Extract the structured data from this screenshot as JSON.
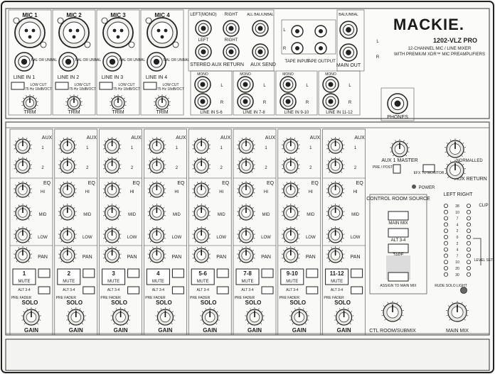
{
  "brand": {
    "logo": "MACKIE.",
    "model": "1202-VLZ PRO",
    "desc1": "12-CHANNEL MIC / LINE MIXER",
    "desc2": "WITH PREMIUM XDR™ MIC PREAMPLIFIERS"
  },
  "mic_inputs": [
    {
      "mic": "MIC 1",
      "line": "LINE IN 1"
    },
    {
      "mic": "MIC 2",
      "line": "LINE IN 2"
    },
    {
      "mic": "MIC 3",
      "line": "LINE IN 3"
    },
    {
      "mic": "MIC 4",
      "line": "LINE IN 4"
    }
  ],
  "io_labels": {
    "trim": "TRIM",
    "low_cut": "LOW CUT",
    "low_cut_sub": "75 Hz 18dB/OCT",
    "bal": "BAL OR UNBAL",
    "left_mono": "LEFT(MONO)",
    "right": "RIGHT",
    "left": "LEFT",
    "all_bal": "ALL BAL/UNBAL",
    "stereo_aux_return": "STEREO AUX RETURN",
    "aux_send": "AUX SEND",
    "tape_input": "TAPE INPUT",
    "tape_output": "TAPE OUTPUT",
    "main_out": "MAIN OUT",
    "balunbal": "BAL/UNBAL",
    "mono": "MONO",
    "l": "L",
    "r": "R",
    "phones": "PHONES"
  },
  "stereo_inputs": [
    "LINE IN 5-6",
    "LINE IN 7-8",
    "LINE IN 9-10",
    "LINE IN 11-12"
  ],
  "strip_labels": {
    "aux": "AUX",
    "aux1": "1",
    "aux2": "2",
    "eq": "EQ",
    "hi": "HI",
    "mid": "MID",
    "low": "LOW",
    "pan": "PAN",
    "mute": "MUTE",
    "alt": "ALT 3-4",
    "pre_fader": "PRE FADER",
    "solo": "SOLO",
    "gain": "GAIN"
  },
  "channels": [
    "1",
    "2",
    "3",
    "4",
    "5-6",
    "7-8",
    "9-10",
    "11-12"
  ],
  "master": {
    "aux1_master": "AUX 1 MASTER",
    "pre_post": "PRE / POST",
    "efx_monitor": "EFX TO MONITOR",
    "normalled": "NORMALLED",
    "aux_return": "AUX RETURN",
    "power": "POWER",
    "crs_title": "CONTROL ROOM SOURCE",
    "main_mix_btn": "MAIN MIX",
    "alt34_btn": "ALT 3-4",
    "tape_btn": "TAPE",
    "assign": "ASSIGN TO MAIN MIX",
    "left_right": "LEFT  RIGHT",
    "clip": "CLIP",
    "level_set": "LEVEL SET",
    "rude_solo": "RUDE SOLO LIGHT",
    "ctl_room": "CTL ROOM/SUBMIX",
    "main_mix": "MAIN MIX",
    "meter_scale": [
      "28",
      "10",
      "7",
      "4",
      "2",
      "0",
      "2",
      "4",
      "7",
      "10",
      "20",
      "30"
    ]
  }
}
